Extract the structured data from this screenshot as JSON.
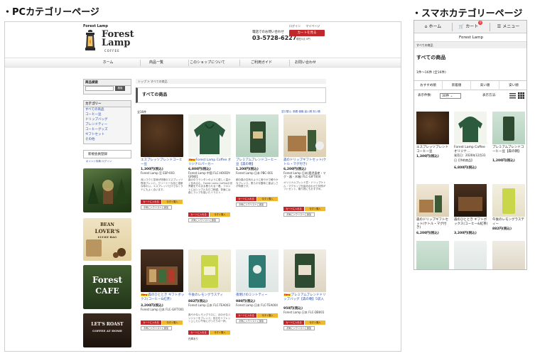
{
  "labels": {
    "pc": "・PCカテゴリーページ",
    "sp": "・スマホカテゴリーページ"
  },
  "pc": {
    "brand_small": "Forest Lamp",
    "logo": {
      "line1": "Forest",
      "line2": "Lamp",
      "line3": "COFFEE"
    },
    "tel_label": "電話でのお問い合わせ",
    "tel": "03-5728-6227",
    "header_links": [
      "ログイン",
      "マイページ"
    ],
    "cart_button": "カートを見る",
    "cart_note": "現在0点 0円",
    "nav": [
      "ホーム",
      "商品一覧",
      "このショップについて",
      "ご利用ガイド",
      "お問い合わせ"
    ],
    "sidebar": {
      "search_title": "商品検索",
      "search_button": "検索",
      "category_title": "カテゴリー",
      "categories": [
        "すべての商品",
        "コーヒー豆",
        "ドリップバッグ",
        "ブレンドティー",
        "コーヒーグッズ",
        "ギフトセット",
        "その他"
      ],
      "member_button": "新規会員登録",
      "member_links": "ポイント特典  ログイン",
      "banners": {
        "forest": "",
        "bean": [
          "BEAN",
          "LOVER'S",
          "LUCKY BAG"
        ],
        "cafe": [
          "Forest",
          "CAFE"
        ],
        "roast": [
          "LET'S ROAST",
          "COFFEE AT HOME"
        ]
      }
    },
    "main": {
      "breadcrumb": "トップ  >  すべての商品",
      "title": "すべての商品",
      "count": "全16件",
      "sort": "並び替え: 新着 価格 高い順 安い順",
      "products": [
        {
          "new": "",
          "name": "エスプレッソブレンドコーヒー豆",
          "price": "1,300円(税込)",
          "sub": "Forest Lamp 豆 ESP-003",
          "desc": "深いコクと苦味が特徴のエスプレッソ専用ブレンド。クリーミーな泡と濃厚な味わい。エスプレッソだけでなくラテにもよく合います。",
          "buttons": [
            "カートに入れる",
            "今すぐ購入"
          ],
          "fav": "お気に入りリストに追加",
          "stock": ""
        },
        {
          "new": "New",
          "name": "Forest Lamp Coffee オリジナルパーカー",
          "price": "6,800円(税込)",
          "sub": "Forest Lamp 中国 FLC-HOODY-GRN01",
          "desc": "森の中でランタンのように優しく温かく包み込む。Forest Lamp Coffeeの世界観をそのまま着られる一着。フロントにはシンプルなロゴ刺繍、背面には森とランプを描いたイラスト…",
          "buttons": [
            "カートに入れる",
            "今すぐ購入"
          ],
          "fav": "お気に入りリストに追加",
          "stock": ""
        },
        {
          "new": "",
          "name": "プレミアムブレンドコーヒー豆【森の朝】",
          "price": "1,200円(税込)",
          "sub": "Forest Lamp 日本 PBC-001",
          "desc": "朝の森の空気のように爽やかで軽やかなブレンド。柔らかな酸味と香ばしさが特徴です。",
          "buttons": [
            "カートに入れる",
            "今すぐ購入"
          ],
          "fav": "お気に入りリストに追加",
          "stock": ""
        },
        {
          "new": "",
          "name": "森のドリップギフトセット(ケトル・マグ付き)",
          "price": "6,200円(税込)",
          "sub": "Forest Lamp 日本(鹿児島産・マグ・器・木箱) FLC-GIFT004",
          "desc": "オリジナルブレンド豆・ドリップケトル・マグカップを組み合わせた特別ギフトセット。贈り物にもおすすめ。",
          "buttons": [
            "カートに入れる",
            "今すぐ購入"
          ],
          "fav": "お気に入りリストに追加",
          "stock": ""
        },
        {
          "new": "New",
          "name": "森のひととき ギフトボックス(コーヒー&紅茶)",
          "price": "3,200円(税込)",
          "sub": "Forest Lamp 日本 FLC-GIFT001",
          "desc": "",
          "buttons": [
            "カートに入れる",
            "今すぐ購入"
          ],
          "fav": "お気に入りリストに追加",
          "stock": ""
        },
        {
          "new": "",
          "name": "午後のレモングラスティ",
          "price": "882円(税込)",
          "sub": "Forest Lamp 日本 FLC-TEA003",
          "desc": "爽やかなレモングラスに、ほのかなジンジャーをブレンド。気分をリフレッシュしたい午後にぴったりの一杯。",
          "buttons": [
            "カートに入れる",
            "今すぐ購入"
          ],
          "fav": "",
          "stock": "在庫あり"
        },
        {
          "new": "",
          "name": "夜明けのミントティー",
          "price": "980円(税込)",
          "sub": "Forest Lamp 日本 FLC-TEA004",
          "desc": "",
          "buttons": [
            "カートに入れる",
            "今すぐ購入"
          ],
          "fav": "お気に入りリストに追加",
          "stock": ""
        },
        {
          "new": "New",
          "name": "プレミアムブレンドドリップバッグ【森の朝】5袋入",
          "price": "950円(税込)",
          "sub": "Forest Lamp 日本 FLC-DB001",
          "desc": "",
          "buttons": [
            "カートに入れる",
            "今すぐ購入"
          ],
          "fav": "お気に入りリストに追加",
          "stock": ""
        }
      ]
    }
  },
  "sp": {
    "tabs": [
      {
        "icon": "home-icon",
        "label": "ホーム"
      },
      {
        "icon": "cart-icon",
        "label": "カート",
        "badge": "0"
      },
      {
        "icon": "menu-icon",
        "label": "メニュー"
      }
    ],
    "store": "Forest Lamp",
    "breadcrumb": "すべての商品",
    "title": "すべての商品",
    "count": "1件〜16件 (全16件)",
    "sort_options": [
      "おすすめ順",
      "新着順",
      "高い順",
      "安い順"
    ],
    "display_count_label": "表示件数:",
    "display_count": "30件",
    "display_method_label": "表示方法:",
    "products": [
      {
        "name": "エスプレッソブレンドコーヒー豆",
        "price": "1,300円(税込)",
        "extra": ""
      },
      {
        "name": "Forest Lamp Coffee オリジナ…",
        "price": "6,800円(税込)",
        "extra": "発売日：2026年12月31日【予約商品】"
      },
      {
        "name": "プレミアムブレンドコーヒー豆【森の朝】",
        "price": "1,200円(税込)",
        "extra": ""
      },
      {
        "name": "森のドリップギフトセット(ケトル・マグ付き)",
        "price": "6,200円(税込)",
        "extra": ""
      },
      {
        "name": "森のひととき ギフトボックス(コーヒー&紅茶)",
        "price": "3,200円(税込)",
        "extra": ""
      },
      {
        "name": "午後のレモングラスティー",
        "price": "882円(税込)",
        "extra": ""
      },
      {
        "name": "",
        "price": "",
        "extra": ""
      },
      {
        "name": "",
        "price": "",
        "extra": ""
      },
      {
        "name": "",
        "price": "",
        "extra": ""
      }
    ]
  },
  "colors": {
    "accent_red": "#c0282b",
    "buy_yellow": "#f1b82c",
    "link_blue": "#2a4fb0"
  }
}
